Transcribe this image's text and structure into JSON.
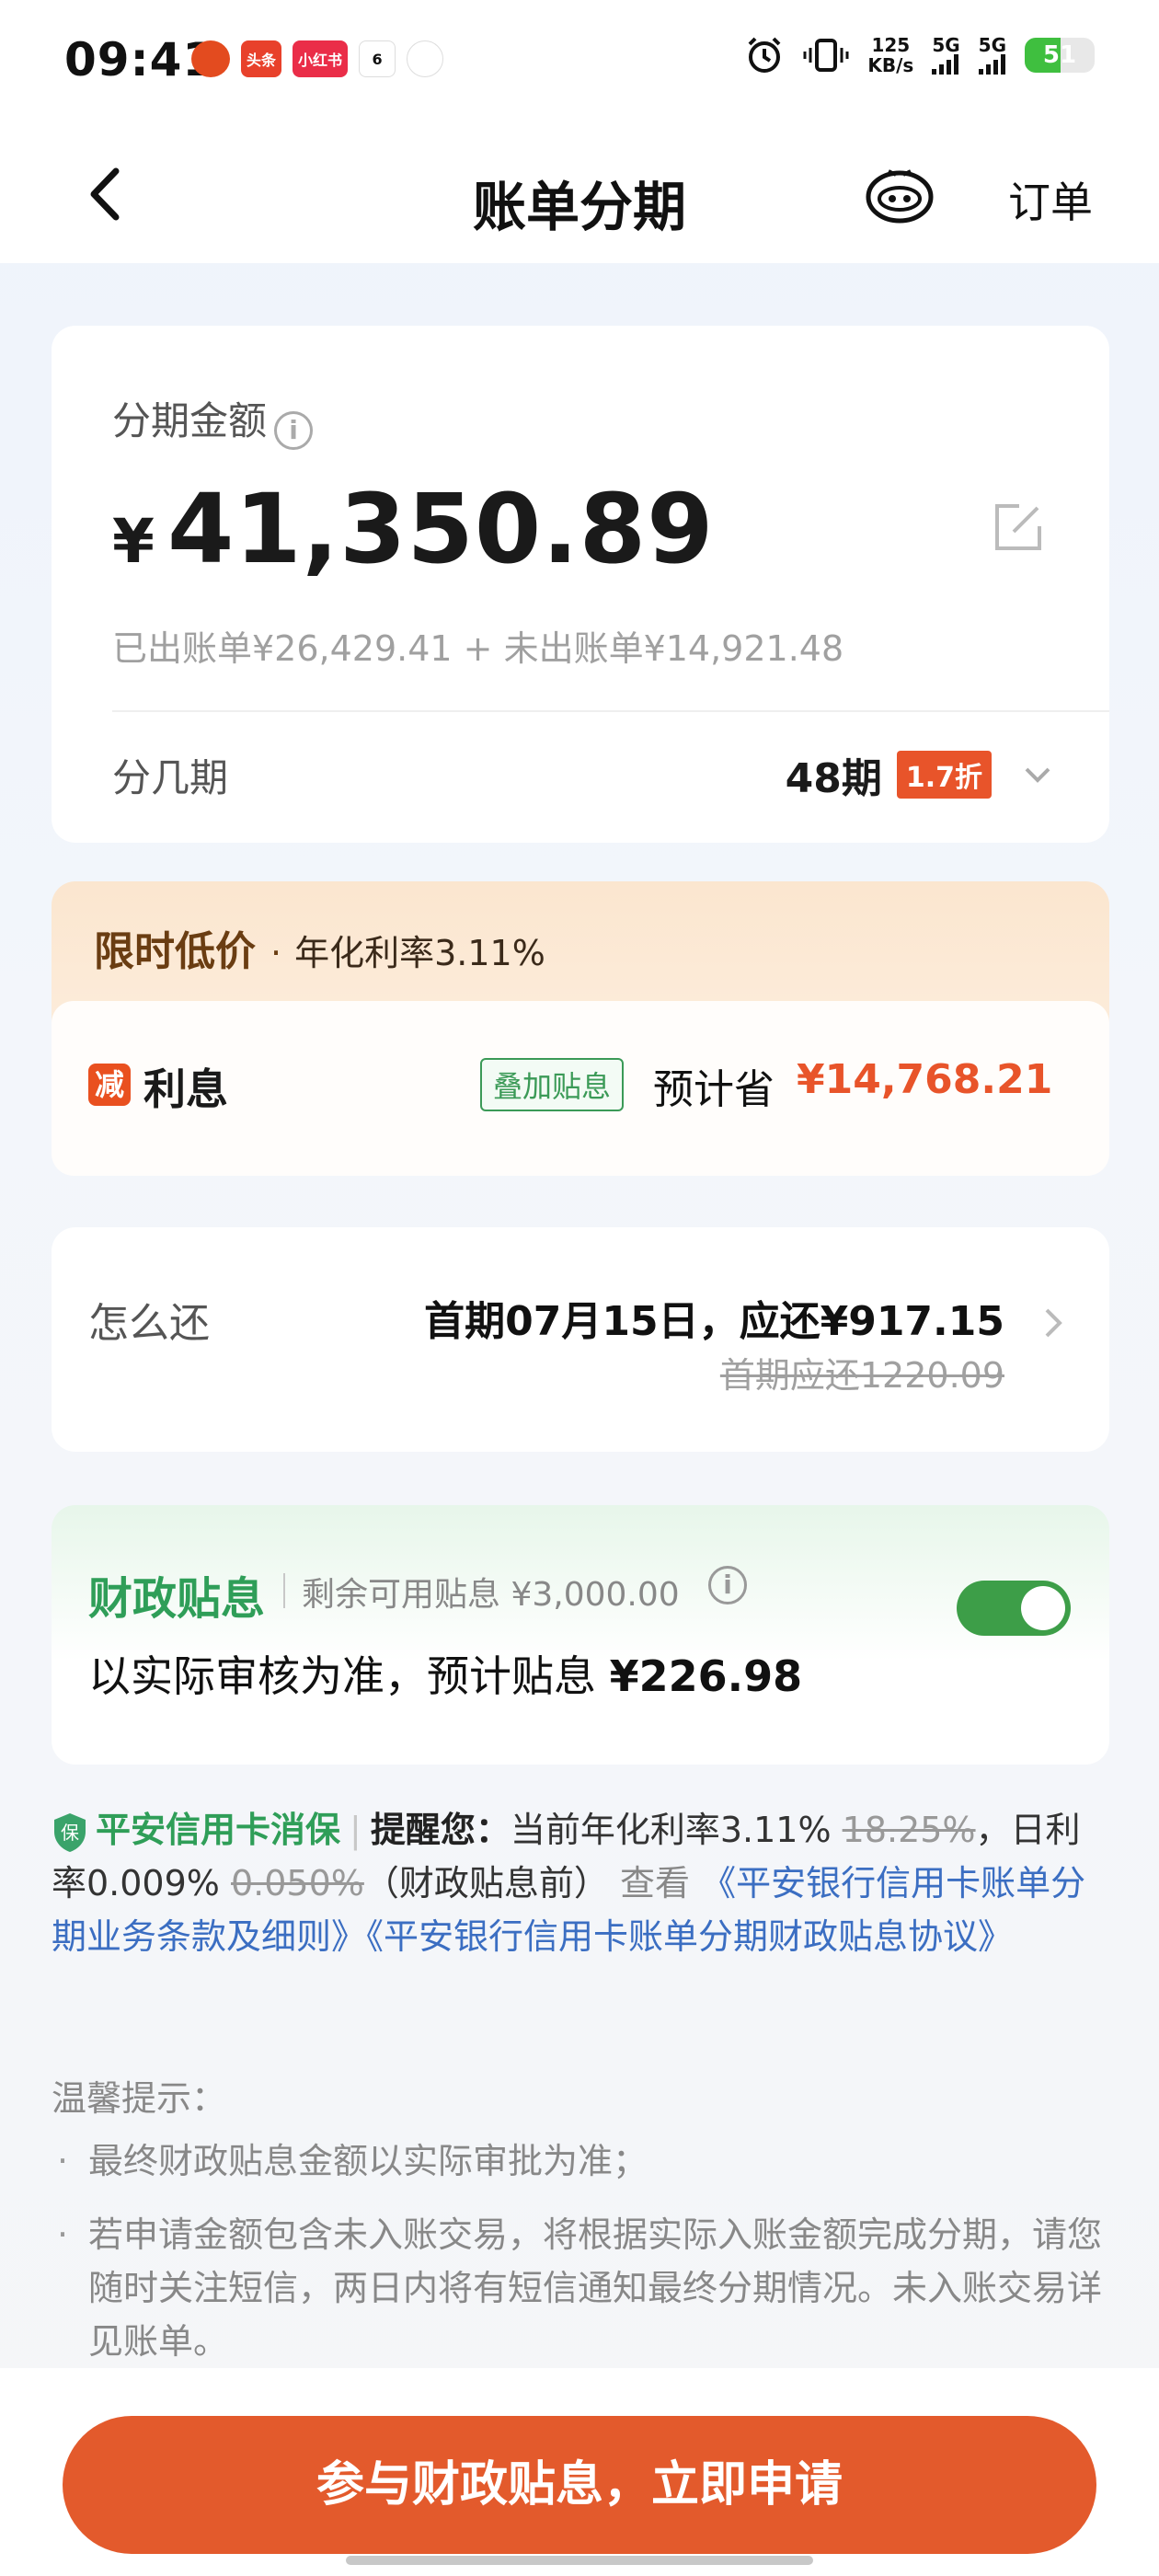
{
  "status_bar": {
    "time": "09:41",
    "apps": [
      {
        "icon": "pumpkin-app-icon",
        "label": "",
        "color": "#e34b1f"
      },
      {
        "icon": "toutiao-app-icon",
        "label": "头条",
        "color": "#e8412b"
      },
      {
        "icon": "xiaohongshu-app-icon",
        "label": "小红书",
        "color": "#ea2d48"
      },
      {
        "icon": "calendar-app-icon",
        "label": "6",
        "color": "#ffffff"
      },
      {
        "icon": "dot-app-icon",
        "label": "",
        "color": "#ffffff"
      }
    ],
    "speed_value": "125",
    "speed_unit": "KB/s",
    "net1": "5G",
    "net2": "5G",
    "battery": "51"
  },
  "header": {
    "title": "账单分期",
    "orders_label": "订单"
  },
  "amount_card": {
    "label": "分期金额",
    "currency": "¥",
    "amount": "41,350.89",
    "breakdown": "已出账单¥26,429.41 + 未出账单¥14,921.48",
    "terms_label": "分几期",
    "terms_value": "48期",
    "discount_badge": "1.7折"
  },
  "promo": {
    "tag": "限时低价",
    "dot": "·",
    "rate_text": "年化利率3.11%",
    "jian_icon": "减",
    "interest_label": "利息",
    "stack_tag": "叠加贴息",
    "save_label": "预计省",
    "save_amount": "¥14,768.21"
  },
  "repay": {
    "label": "怎么还",
    "first_payment": "首期07月15日，应还¥917.15",
    "original": "首期应还1220.09"
  },
  "subsidy": {
    "title": "财政贴息",
    "remaining": "剩余可用贴息 ¥3,000.00",
    "toggle_on": true,
    "line_prefix": "以实际审核为准，预计贴息 ",
    "line_amount": "¥226.98"
  },
  "notice": {
    "brand": "平安信用卡消保",
    "remind_label": "提醒您：",
    "text1": "当前年化利率3.11% ",
    "strike1": "18.25%",
    "text2": "，日利率0.009% ",
    "strike2": "0.050%",
    "text3": "（财政贴息前） ",
    "view": "查看 ",
    "link1": "《平安银行信用卡账单分期业务条款及细则》",
    "link2": "《平安银行信用卡账单分期财政贴息协议》"
  },
  "tips": {
    "title": "温馨提示：",
    "items": [
      "最终财政贴息金额以实际审批为准；",
      "若申请金额包含未入账交易，将根据实际入账金额完成分期，请您随时关注短信，两日内将有短信通知最终分期情况。未入账交易详见账单。"
    ]
  },
  "cta": {
    "label": "参与财政贴息，立即申请"
  }
}
